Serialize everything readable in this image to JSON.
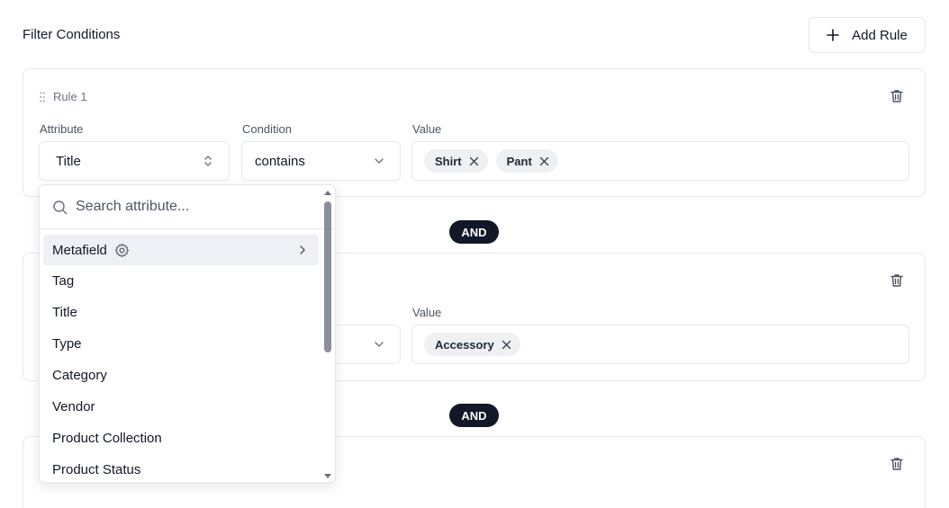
{
  "header": {
    "title": "Filter Conditions",
    "add_rule_label": "Add Rule"
  },
  "labels": {
    "attribute": "Attribute",
    "condition": "Condition",
    "value": "Value"
  },
  "rules": [
    {
      "name": "Rule 1",
      "attribute": "Title",
      "condition": "contains",
      "values": [
        "Shirt",
        "Pant"
      ]
    },
    {
      "values": [
        "Accessory"
      ]
    }
  ],
  "connector": "AND",
  "dropdown": {
    "search_placeholder": "Search attribute...",
    "items": [
      "Metafield",
      "Tag",
      "Title",
      "Type",
      "Category",
      "Vendor",
      "Product Collection",
      "Product Status"
    ]
  },
  "colors": {
    "and_pill": "#111827",
    "chip_bg": "#eef0f4",
    "active_item_bg": "#eef0f5"
  }
}
